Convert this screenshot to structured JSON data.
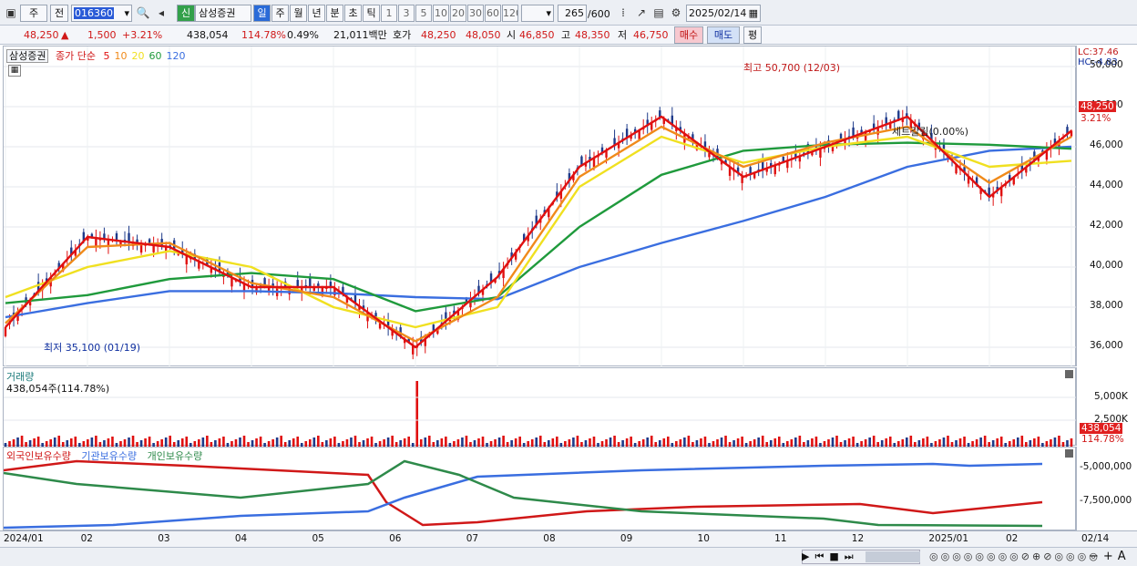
{
  "toolbar": {
    "period_type": "주",
    "prefix": "전",
    "code": "016360",
    "stock_name": "삼성증권",
    "badge": "신",
    "periods": [
      "일",
      "주",
      "월",
      "년",
      "분",
      "초",
      "틱"
    ],
    "intervals": [
      "1",
      "3",
      "5",
      "10",
      "20",
      "30",
      "60",
      "120"
    ],
    "count": "265",
    "max_count": "/600",
    "date": "2025/02/14"
  },
  "quote": {
    "price": "48,250",
    "arrow": "▲",
    "change": "1,500",
    "change_pct": "+3.21%",
    "volume": "438,054",
    "vol_ratio": "114.78%",
    "turnover": "0.49%",
    "amount": "21,011백만",
    "hoga_label": "호가",
    "ask": "48,250",
    "bid": "48,050",
    "open_label": "시",
    "open": "46,850",
    "high_label": "고",
    "high": "48,350",
    "low_label": "저",
    "low": "46,750",
    "buy": "매수",
    "sell": "매도",
    "eval": "평"
  },
  "legend": {
    "stock": "삼성증권",
    "title": "종가 단순",
    "ma": [
      {
        "label": "5",
        "color": "#e01010"
      },
      {
        "label": "10",
        "color": "#f08a1a"
      },
      {
        "label": "20",
        "color": "#f0e020"
      },
      {
        "label": "60",
        "color": "#1f9a3c"
      },
      {
        "label": "120",
        "color": "#3a6ee0"
      }
    ]
  },
  "price_scale": {
    "lc": "LC:37.46",
    "hc": "HC:-4.83",
    "current": "48,250",
    "current_pct": "3.21%"
  },
  "annotations": {
    "high": "최고 50,700 (12/03)",
    "low": "최저 35,100 (01/19)",
    "cross": "세트갈림(0.00%)"
  },
  "volume_panel": {
    "title": "거래량",
    "value": "438,054주(114.78%)",
    "scale": [
      "5,000K",
      "2,500K"
    ],
    "current": "438,054",
    "current_pct": "114.78%"
  },
  "holdings_panel": {
    "legend": [
      "외국인보유수량",
      "기관보유수량",
      "개인보유수량"
    ],
    "scale": [
      "-5,000,000",
      "-7,500,000"
    ]
  },
  "x_axis": {
    "labels": [
      "2024/01",
      "02",
      "03",
      "04",
      "05",
      "06",
      "07",
      "08",
      "09",
      "10",
      "11",
      "12",
      "2025/01",
      "02",
      "02/14"
    ]
  },
  "chart_data": {
    "type": "line",
    "x": [
      "2024/01",
      "02",
      "03",
      "04",
      "05",
      "06",
      "07",
      "08",
      "09",
      "10",
      "11",
      "12",
      "2025/01",
      "02"
    ],
    "ylim": [
      35000,
      51000
    ],
    "y_ticks": [
      36000,
      38000,
      40000,
      42000,
      44000,
      46000,
      48000,
      50000
    ],
    "series": [
      {
        "name": "5",
        "color": "#e01010",
        "values": [
          37000,
          41500,
          41000,
          39000,
          39000,
          36000,
          39500,
          45000,
          47500,
          44500,
          46000,
          47500,
          43500,
          46800
        ]
      },
      {
        "name": "10",
        "color": "#f08a1a",
        "values": [
          37200,
          41000,
          41200,
          39200,
          38500,
          36300,
          38500,
          44500,
          47000,
          45000,
          46200,
          47000,
          44200,
          46500
        ]
      },
      {
        "name": "20",
        "color": "#f0e020",
        "values": [
          38500,
          40000,
          40800,
          40000,
          38000,
          37000,
          38000,
          44000,
          46500,
          45200,
          46000,
          46500,
          45000,
          45300
        ]
      },
      {
        "name": "60",
        "color": "#1f9a3c",
        "values": [
          38200,
          38600,
          39400,
          39700,
          39400,
          37800,
          38500,
          42000,
          44600,
          45800,
          46100,
          46200,
          46100,
          45900
        ]
      },
      {
        "name": "120",
        "color": "#3a6ee0",
        "values": [
          37500,
          38200,
          38800,
          38800,
          38700,
          38500,
          38400,
          40000,
          41200,
          42300,
          43500,
          45000,
          45800,
          46000
        ]
      }
    ]
  }
}
